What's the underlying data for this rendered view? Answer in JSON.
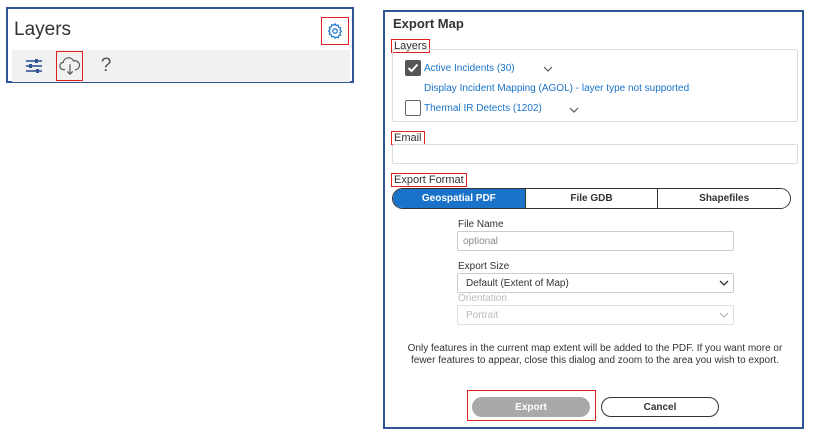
{
  "layers_panel": {
    "title": "Layers",
    "settings_icon": "gear-icon",
    "toolbar": {
      "filter_icon": "sliders-icon",
      "export_icon": "cloud-download-icon",
      "help_label": "?"
    }
  },
  "export_map": {
    "title": "Export Map",
    "layers_section": {
      "label": "Layers",
      "items": [
        {
          "label": "Active Incidents (30)",
          "checked": true,
          "expandable": true
        },
        {
          "label": "Display Incident Mapping (AGOL) - layer type not supported",
          "checked": false,
          "expandable": false
        },
        {
          "label": "Thermal IR Detects (1202)",
          "checked": false,
          "expandable": true
        }
      ]
    },
    "email": {
      "label": "Email",
      "value": "",
      "placeholder": ""
    },
    "format": {
      "label": "Export Format",
      "options": [
        "Geospatial PDF",
        "File GDB",
        "Shapefiles"
      ],
      "selected": "Geospatial PDF"
    },
    "file_name": {
      "label": "File Name",
      "placeholder": "optional"
    },
    "export_size": {
      "label": "Export Size",
      "selected": "Default (Extent of Map)"
    },
    "orientation": {
      "label": "Orientation",
      "selected": "Portrait",
      "disabled": true
    },
    "note": "Only features in the current map extent will be added to the PDF. If you want more or fewer features to appear, close this dialog and zoom to the area you wish to export.",
    "buttons": {
      "export": "Export",
      "cancel": "Cancel"
    }
  },
  "colors": {
    "panel_border": "#2f5597",
    "highlight": "#e02020",
    "accent": "#1a73c9",
    "disabled_button": "#a9a9a9"
  }
}
